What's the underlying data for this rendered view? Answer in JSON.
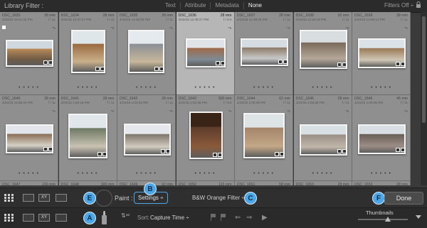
{
  "filter_bar": {
    "title": "Library Filter :",
    "options": [
      "Text",
      "Attribute",
      "Metadata",
      "None"
    ],
    "active": "None",
    "filters_off": "Filters Off ÷"
  },
  "grid": {
    "row1": [
      {
        "name": "DSC_1633",
        "focal": "28 mm",
        "date": "4/23/16 12:44:44 PM",
        "fstop": "f / 11"
      },
      {
        "name": "DSC_1634",
        "focal": "28 mm",
        "date": "4/23/16 12:47:27 PM",
        "fstop": "f / 11"
      },
      {
        "name": "DSC_1635",
        "focal": "28 mm",
        "date": "4/23/16 12:48:00 PM",
        "fstop": "f / 11"
      },
      {
        "name": "DSC_1636",
        "focal": "28 mm",
        "date": "4/23/16 12:48:27 PM",
        "fstop": "f / 9.0"
      },
      {
        "name": "DSC_1637",
        "focal": "28 mm",
        "date": "4/23/16 12:49:42 PM",
        "fstop": "f / 11"
      },
      {
        "name": "DSC_1638",
        "focal": "52 mm",
        "date": "4/23/16 12:53:16 PM",
        "fstop": "f / 11"
      },
      {
        "name": "DSC_1639",
        "focal": "28 mm",
        "date": "4/23/16 12:55:12 PM",
        "fstop": "f / 11"
      }
    ],
    "row2": [
      {
        "name": "DSC_1640",
        "focal": "28 mm",
        "date": "4/23/16 12:58:42 PM",
        "fstop": "f / 11"
      },
      {
        "name": "DSC_1641",
        "focal": "28 mm",
        "date": "4/23/16 1:00:16 PM",
        "fstop": "f / 11"
      },
      {
        "name": "DSC_1642",
        "focal": "28 mm",
        "date": "4/23/16 1:02:03 PM",
        "fstop": "f / 11"
      },
      {
        "name": "DSC_1643",
        "focal": "300 mm",
        "date": "4/23/16 1:03:48 PM",
        "fstop": "f / 5.6"
      },
      {
        "name": "DSC_1644",
        "focal": "62 mm",
        "date": "4/23/16 1:05:06 PM",
        "fstop": "f / 11"
      },
      {
        "name": "DSC_1645",
        "focal": "28 mm",
        "date": "4/23/16 1:06:38 PM",
        "fstop": "f / 11"
      },
      {
        "name": "DSC_1646",
        "focal": "45 mm",
        "date": "4/23/16 1:09:06 PM",
        "fstop": "f / 11"
      }
    ],
    "row3": [
      {
        "name": "DSC_1647",
        "focal": "230 mm"
      },
      {
        "name": "DSC_1648",
        "focal": "300 mm"
      },
      {
        "name": "DSC_1649",
        "focal": "62 mm"
      },
      {
        "name": "DSC_1650",
        "focal": "115 mm"
      },
      {
        "name": "DSC_1651",
        "focal": "58 mm"
      },
      {
        "name": "DSC_1653",
        "focal": "28 mm"
      },
      {
        "name": "DSC_1653",
        "focal": "28 mm"
      }
    ]
  },
  "painter_toolbar": {
    "paint_label": "Paint :",
    "paint_value": "Settings ÷",
    "preset": "B&W Orange Filter ÷",
    "done": "Done"
  },
  "bottom_toolbar": {
    "sort_label": "Sort:",
    "sort_value": "Capture Time ÷",
    "thumbnails_label": "Thumbnails"
  },
  "callouts": {
    "a": "A",
    "b": "B",
    "c": "C",
    "e": "E",
    "f": "F"
  },
  "colors": {
    "callout": "#4da7e7",
    "selected_cell": "#b6b6b6",
    "cell": "#8f8f8f"
  }
}
